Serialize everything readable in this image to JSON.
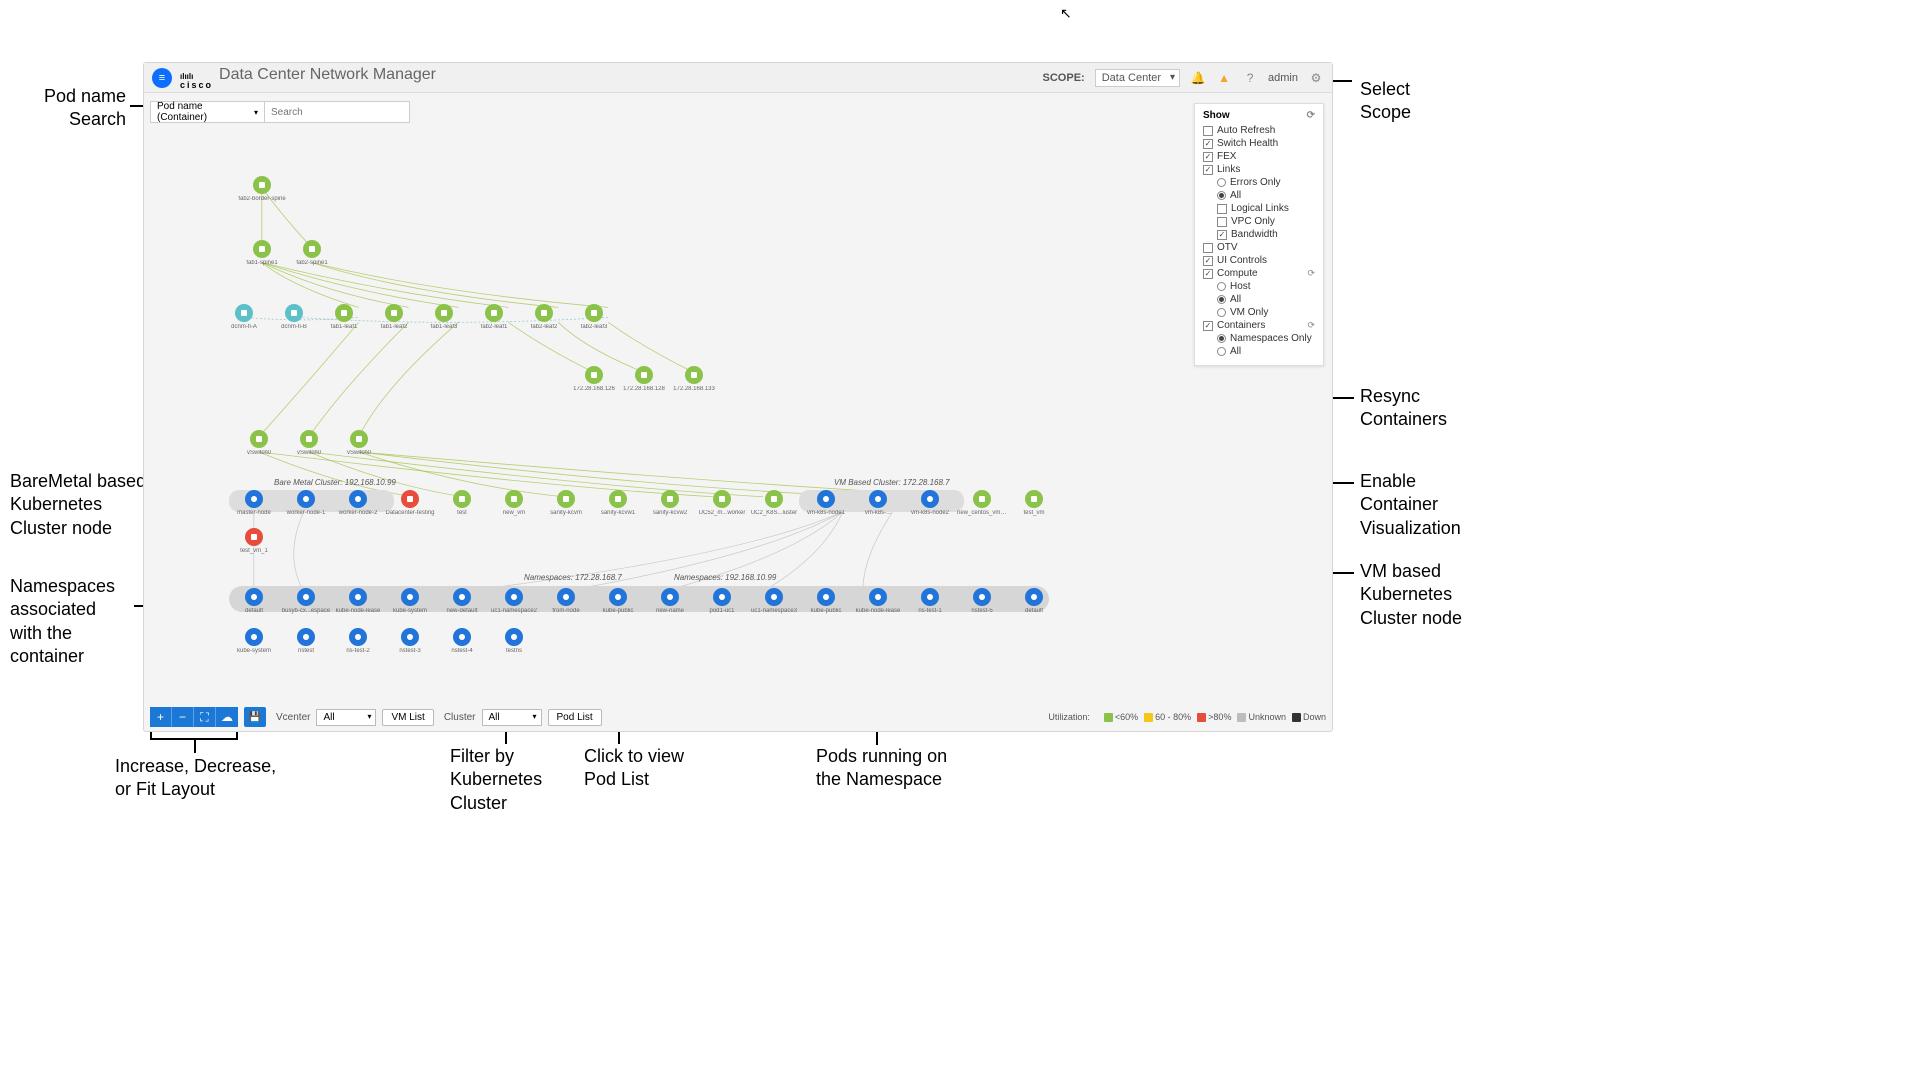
{
  "header": {
    "app_title": "Data Center Network Manager",
    "vendor": "cisco",
    "scope_label": "SCOPE:",
    "scope_value": "Data Center",
    "user": "admin"
  },
  "search": {
    "filter_label": "Pod name (Container)",
    "placeholder": "Search"
  },
  "show_panel": {
    "title": "Show",
    "auto_refresh": "Auto Refresh",
    "switch_health": "Switch Health",
    "fex": "FEX",
    "links": "Links",
    "errors_only": "Errors Only",
    "all1": "All",
    "logical_links": "Logical Links",
    "vpc_only": "VPC Only",
    "bandwidth": "Bandwidth",
    "otv": "OTV",
    "ui_controls": "UI Controls",
    "compute": "Compute",
    "host": "Host",
    "all2": "All",
    "vm_only": "VM Only",
    "containers": "Containers",
    "namespaces_only": "Namespaces Only",
    "all3": "All"
  },
  "topology": {
    "spine": {
      "label": "fab2-border-spine"
    },
    "row2": [
      {
        "label": "fab1-spine1"
      },
      {
        "label": "fab2-spine1"
      }
    ],
    "row3": [
      {
        "label": "dcnm-fi-A",
        "kind": "teal"
      },
      {
        "label": "dcnm-fi-B",
        "kind": "teal"
      },
      {
        "label": "fab1-leaf1"
      },
      {
        "label": "fab1-leaf2"
      },
      {
        "label": "fab1-leaf3"
      },
      {
        "label": "fab2-leaf1"
      },
      {
        "label": "fab2-leaf2"
      },
      {
        "label": "fab2-leaf3"
      }
    ],
    "row4": [
      {
        "label": "172.28.168.126"
      },
      {
        "label": "172.28.168.128"
      },
      {
        "label": "172.28.168.133"
      }
    ],
    "row5": [
      {
        "label": "vSwitch0"
      },
      {
        "label": "vSwitch0"
      },
      {
        "label": "vSwitch0"
      }
    ],
    "bare_cluster_label": "Bare Metal Cluster: 192.168.10.99",
    "vm_cluster_label": "VM Based Cluster: 172.28.168.7",
    "row6": [
      {
        "label": "master-node",
        "kind": "blue"
      },
      {
        "label": "worker-node-1",
        "kind": "blue"
      },
      {
        "label": "worker-node-2",
        "kind": "blue"
      },
      {
        "label": "Datacenter-testing",
        "kind": "red"
      },
      {
        "label": "test"
      },
      {
        "label": "new_vm"
      },
      {
        "label": "sanity-kcvm"
      },
      {
        "label": "sanity-kcvw1"
      },
      {
        "label": "sanity-kcvw2"
      },
      {
        "label": "UC52_m...worker"
      },
      {
        "label": "UC2_K8S...luster"
      },
      {
        "label": "vm-k8s-node1",
        "kind": "blue"
      },
      {
        "label": "vm-k8s-...",
        "kind": "blue"
      },
      {
        "label": "vm-k8s-node2",
        "kind": "blue"
      },
      {
        "label": "new_centos_vm_8"
      },
      {
        "label": "test_vm"
      }
    ],
    "row6b": [
      {
        "label": "test_vm_1",
        "kind": "red"
      }
    ],
    "ns_label1": "Namespaces: 172.28.168.7",
    "ns_label2": "Namespaces: 192.168.10.99",
    "row7": [
      {
        "label": "default"
      },
      {
        "label": "busyb-cx...espace"
      },
      {
        "label": "kube-node-lease"
      },
      {
        "label": "kube-system"
      },
      {
        "label": "new-default"
      },
      {
        "label": "uc1-namespace2"
      },
      {
        "label": "from-node"
      },
      {
        "label": "kube-public"
      },
      {
        "label": "new-name"
      },
      {
        "label": "pod1-uc1"
      },
      {
        "label": "uc1-namespace3"
      },
      {
        "label": "kube-public"
      },
      {
        "label": "kube-node-lease"
      },
      {
        "label": "ns-test-1"
      },
      {
        "label": "nstest-5"
      },
      {
        "label": "default"
      }
    ],
    "row8": [
      {
        "label": "kube-system"
      },
      {
        "label": "nstest"
      },
      {
        "label": "ns-test-2"
      },
      {
        "label": "nstest-3"
      },
      {
        "label": "nstest-4"
      },
      {
        "label": "testns"
      }
    ]
  },
  "bottombar": {
    "vcenter_label": "Vcenter",
    "vcenter_value": "All",
    "vmlist_btn": "VM List",
    "cluster_label": "Cluster",
    "cluster_value": "All",
    "podlist_btn": "Pod List",
    "legend_label": "Utilization:",
    "legend": [
      {
        "color": "#8bc34a",
        "label": "<60%"
      },
      {
        "color": "#f5c518",
        "label": "60 - 80%"
      },
      {
        "color": "#e74c3c",
        "label": ">80%"
      },
      {
        "color": "#bdbdbd",
        "label": "Unknown"
      },
      {
        "color": "#333",
        "label": "Down"
      }
    ]
  },
  "annotations": {
    "pod_search": "Pod name\nSearch",
    "select_scope": "Select\nScope",
    "resync": "Resync\nContainers",
    "enable_viz": "Enable\nContainer\nVisualization",
    "baremetal": "BareMetal based\nKubernetes\nCluster node",
    "vm_node": "VM based\nKubernetes\nCluster node",
    "namespaces": "Namespaces\nassociated\nwith the\ncontainer",
    "zoom": "Increase, Decrease,\nor Fit Layout",
    "cluster_filter": "Filter by\nKubernetes\nCluster",
    "podlist": "Click to view\nPod List",
    "pods_ns": "Pods running on\nthe Namespace"
  }
}
